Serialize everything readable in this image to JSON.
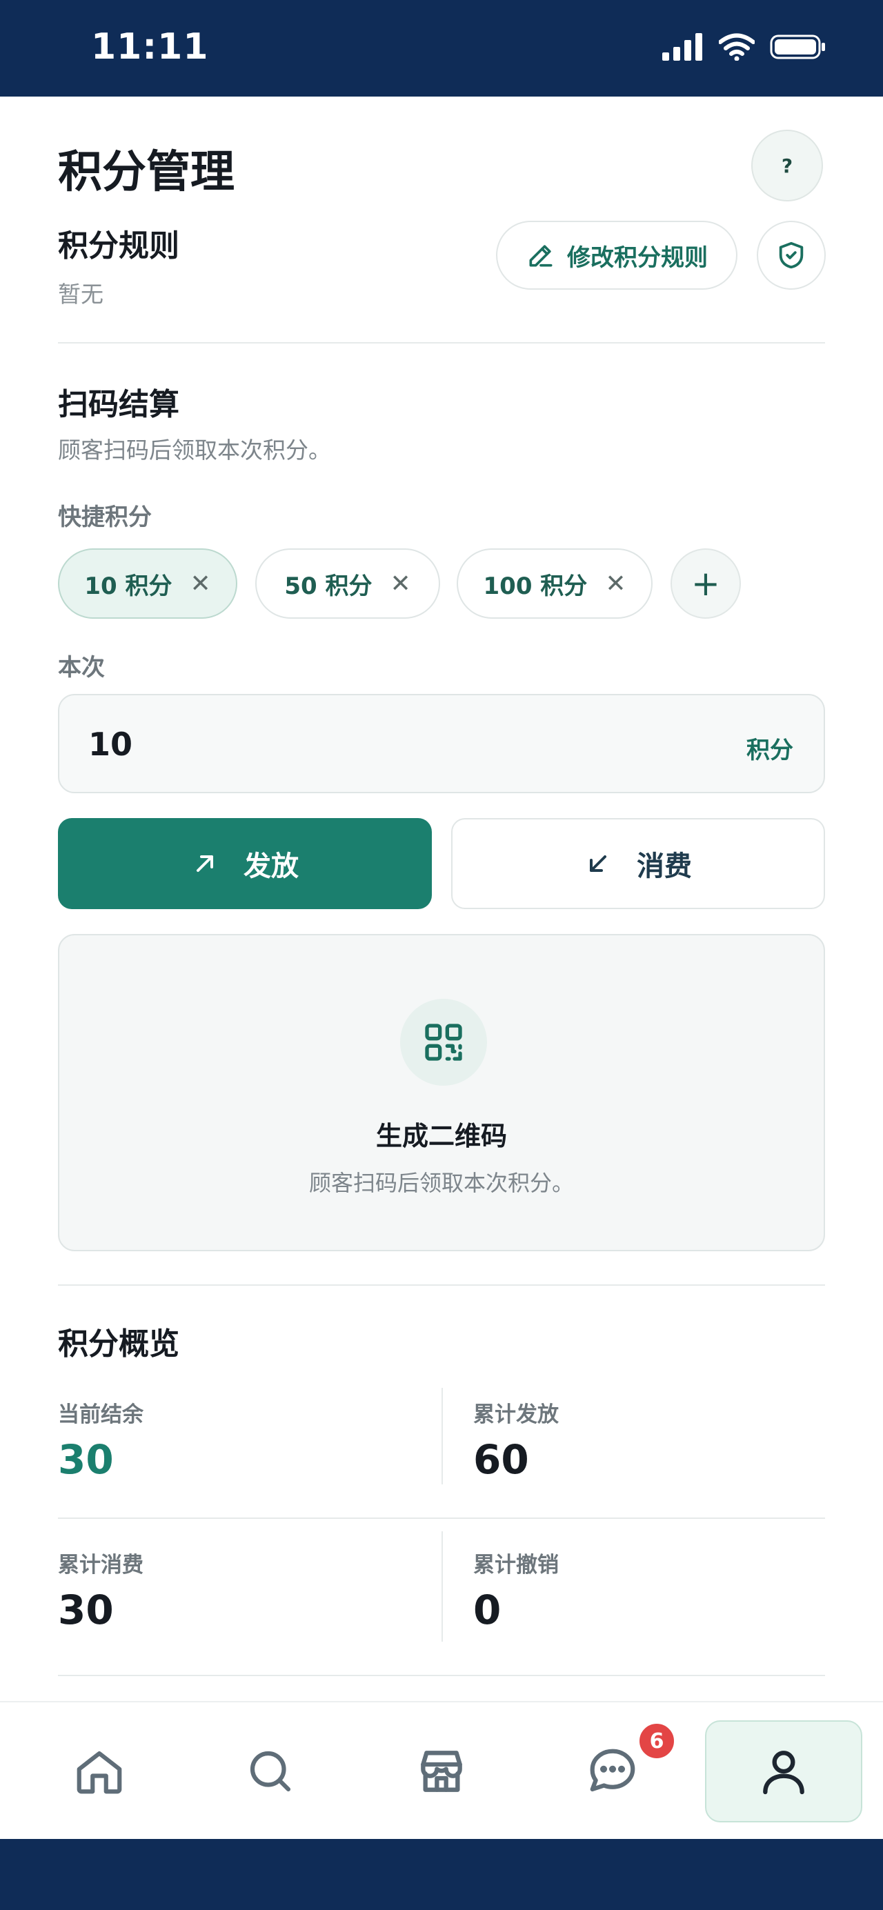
{
  "status_bar": {
    "time": "11:11"
  },
  "header": {
    "title": "积分管理",
    "help_label": "?"
  },
  "rules": {
    "title": "积分规则",
    "value": "暂无",
    "edit_label": "修改积分规则"
  },
  "scan": {
    "title": "扫码结算",
    "description": "顾客扫码后领取本次积分。",
    "quick_label": "快捷积分",
    "chips": [
      {
        "label": "10 积分",
        "selected": true
      },
      {
        "label": "50 积分",
        "selected": false
      },
      {
        "label": "100 积分",
        "selected": false
      }
    ],
    "amount_label": "本次",
    "amount_value": "10",
    "amount_unit": "积分",
    "issue_label": "发放",
    "consume_label": "消费"
  },
  "qr": {
    "title": "生成二维码",
    "description": "顾客扫码后领取本次积分。"
  },
  "overview": {
    "title": "积分概览",
    "stats": [
      {
        "label": "当前结余",
        "value": "30"
      },
      {
        "label": "累计发放",
        "value": "60"
      },
      {
        "label": "累计消费",
        "value": "30"
      },
      {
        "label": "累计撤销",
        "value": "0"
      }
    ]
  },
  "nav": {
    "messages_badge": "6",
    "active": "profile"
  },
  "colors": {
    "accent": "#1b7f6e",
    "status_bar": "#0f2c57",
    "badge": "#e34545"
  }
}
